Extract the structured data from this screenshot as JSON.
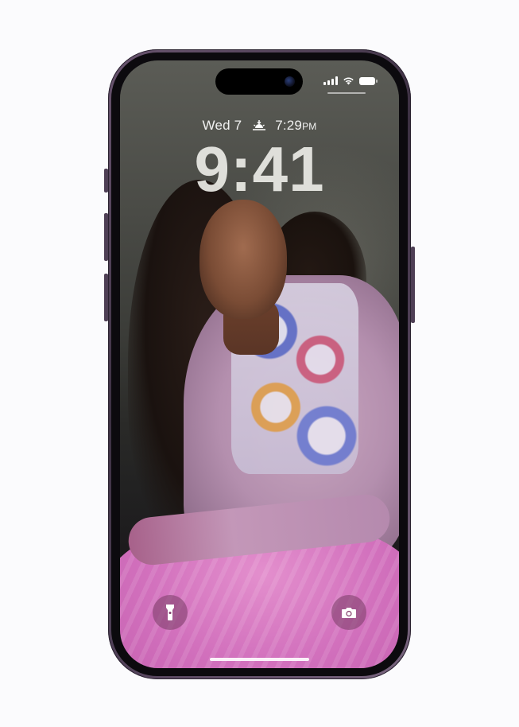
{
  "lockscreen": {
    "date": "Wed 7",
    "sunset_time": "7:29",
    "sunset_ampm": "PM",
    "clock": "9:41"
  },
  "status_bar": {
    "icons": [
      "cellular-signal-icon",
      "wifi-icon",
      "battery-icon"
    ]
  },
  "controls": {
    "left": "flashlight-icon",
    "right": "camera-icon"
  },
  "colors": {
    "frame": "#3d3143",
    "skirt_pink": "#d271bd",
    "control_bg": "#7a3c64"
  }
}
